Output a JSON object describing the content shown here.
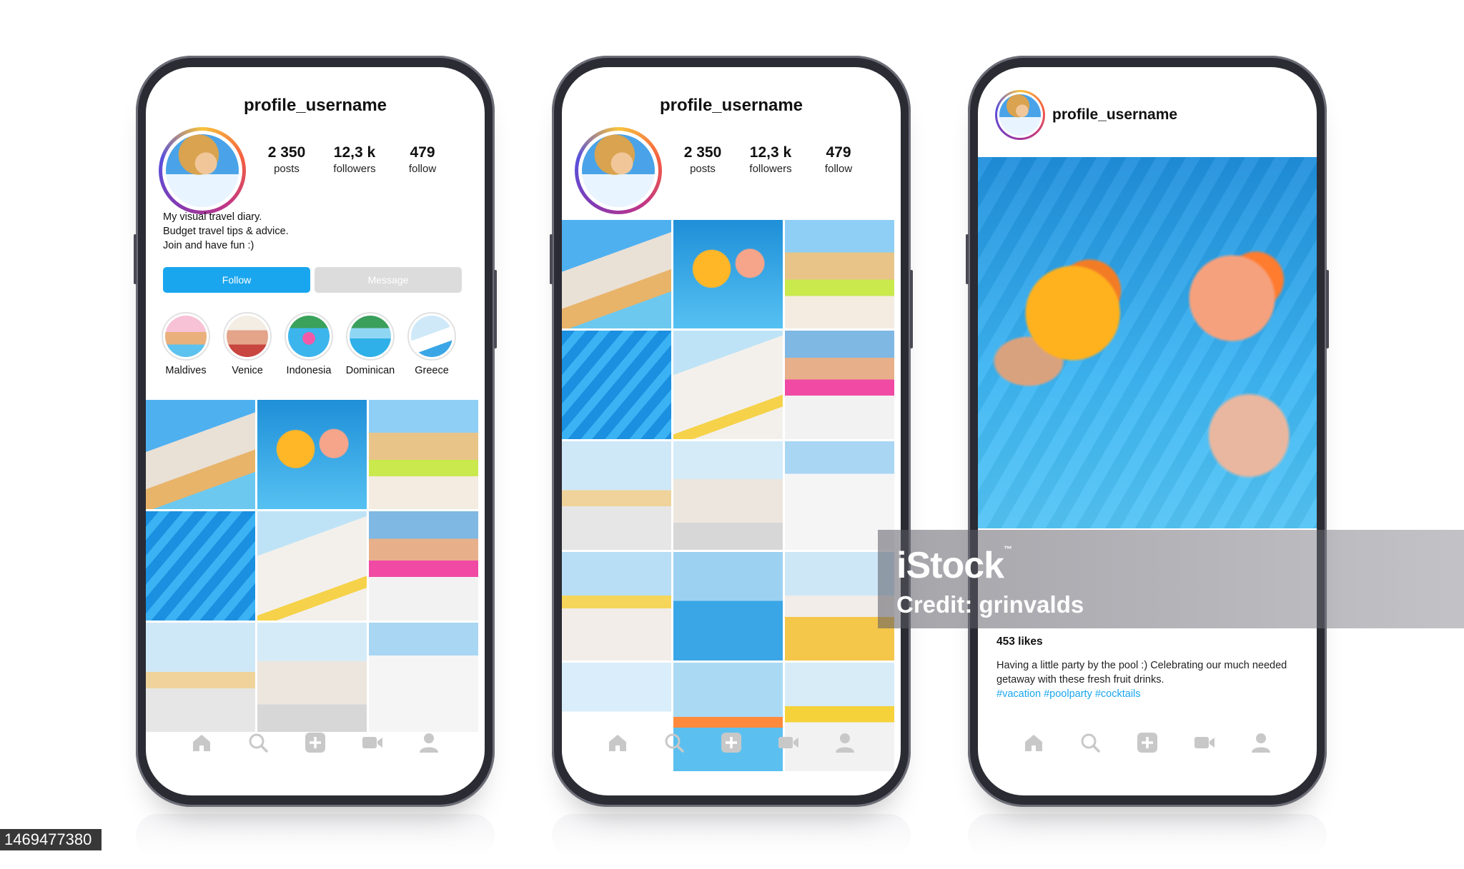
{
  "profile": {
    "username": "profile_username",
    "stats": [
      {
        "value": "2 350",
        "label": "posts"
      },
      {
        "value": "12,3 k",
        "label": "followers"
      },
      {
        "value": "479",
        "label": "follow"
      }
    ],
    "bio": [
      "My visual travel diary.",
      "Budget travel tips & advice.",
      "Join and have fun :)"
    ],
    "follow_label": "Follow",
    "message_label": "Message",
    "highlights": [
      "Maldives",
      "Venice",
      "Indonesia",
      "Dominican",
      "Greece"
    ]
  },
  "post": {
    "username": "profile_username",
    "likes": "453 likes",
    "caption": "Having a little party by the pool :) Celebrating our much needed getaway with these fresh fruit drinks.",
    "tags": "#vacation #poolparty #cocktails"
  },
  "nav_icons": [
    "home-icon",
    "search-icon",
    "add-post-icon",
    "video-icon",
    "profile-icon"
  ],
  "colors": {
    "accent": "#1aa6ee",
    "message_bg": "#dcdcdc",
    "phone_frame": "#2b2b33"
  },
  "watermark": {
    "logo": "iStock",
    "credit": "Credit: grinvalds",
    "image_id": "1469477380"
  }
}
